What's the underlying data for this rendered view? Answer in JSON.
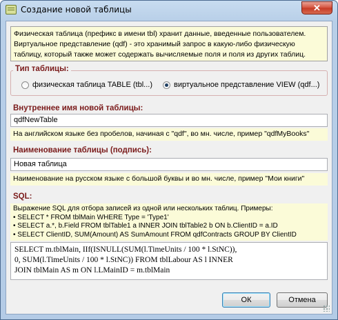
{
  "window": {
    "title": "Создание новой таблицы",
    "close_glyph": "✕"
  },
  "info_lines": [
    "Физическая таблица (префикс в имени tbl) хранит данные, введенные пользователем.",
    "Виртуальное представление (qdf) - это хранимый запрос в какую-либо физическую",
    "таблицу, который также может содержать вычисляемые поля и поля из других таблиц."
  ],
  "table_type": {
    "label": "Тип таблицы:",
    "options": [
      {
        "label": "физическая таблица TABLE (tbl...)",
        "selected": false
      },
      {
        "label": "виртуальное представление VIEW (qdf...)",
        "selected": true
      }
    ]
  },
  "internal_name": {
    "label": "Внутреннее имя новой таблицы:",
    "value": "qdfNewTable",
    "hint": "На английском языке без пробелов, начиная с \"qdf\", во мн. числе, пример \"qdfMyBooks\""
  },
  "caption": {
    "label": "Наименование таблицы (подпись):",
    "value": "Новая таблица",
    "hint": "Наименование на русском языке с большой буквы и во мн. числе, пример \"Мои книги\""
  },
  "sql": {
    "label": "SQL:",
    "help_lines": [
      "Выражение SQL для отбора записей из одной или нескольких таблиц. Примеры:",
      "• SELECT * FROM tblMain WHERE Type = 'Type1'",
      "• SELECT a.*, b.Field FROM tblTable1 a INNER JOIN tblTable2 b ON b.ClientID = a.ID",
      "• SELECT ClientID, SUM(Amount) AS SumAmount FROM qdfContracts GROUP BY ClientID"
    ],
    "query_lines": [
      "SELECT m.tblMain, IIf(ISNULL(SUM(l.TimeUnits / 100 * l.StNC)),",
      "0, SUM(l.TimeUnits / 100 * l.StNC)) FROM tblLabour AS l INNER",
      "JOIN tblMain AS m ON l.LMainID = m.tblMain"
    ]
  },
  "buttons": {
    "ok": "ОК",
    "cancel": "Отмена"
  }
}
